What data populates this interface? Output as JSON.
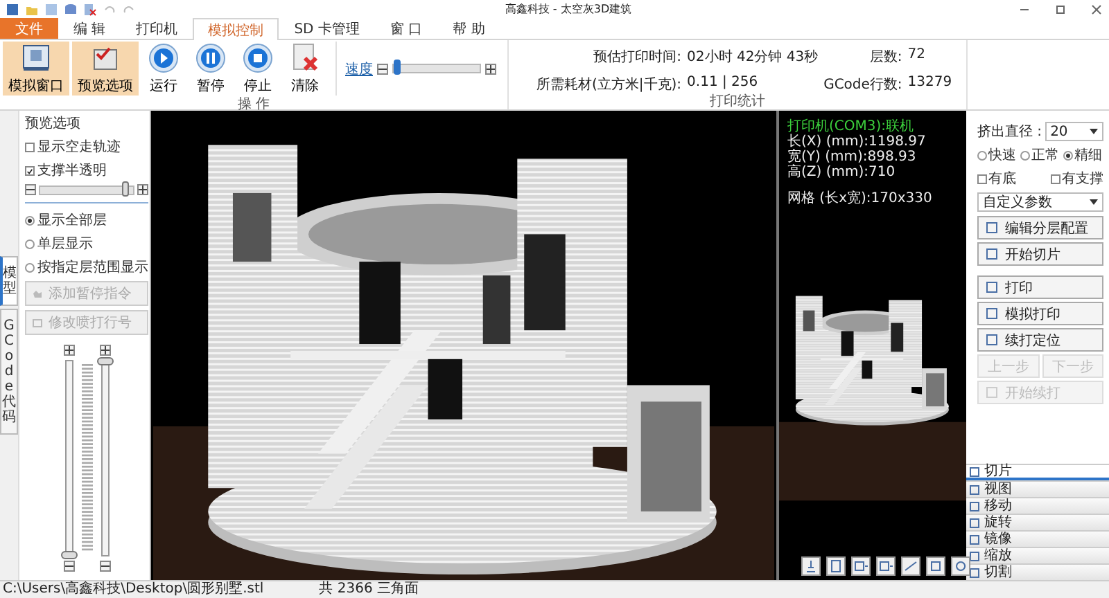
{
  "title_bar": {
    "title": "高鑫科技 - 太空灰3D建筑"
  },
  "menu_tabs": [
    {
      "label": "文件",
      "kind": "file",
      "selected": false
    },
    {
      "label": "编 辑",
      "kind": "tab",
      "selected": false
    },
    {
      "label": "打印机",
      "kind": "tab",
      "selected": false
    },
    {
      "label": "模拟控制",
      "kind": "tab",
      "selected": true
    },
    {
      "label": "SD 卡管理",
      "kind": "tab",
      "selected": false
    },
    {
      "label": "窗 口",
      "kind": "tab",
      "selected": false
    },
    {
      "label": "帮 助",
      "kind": "tab",
      "selected": false
    }
  ],
  "ribbon": {
    "buttons": [
      {
        "label": "模拟窗口",
        "kind": "window",
        "selected": true
      },
      {
        "label": "预览选项",
        "kind": "options",
        "selected": true
      },
      {
        "label": "运行",
        "kind": "play",
        "selected": false
      },
      {
        "label": "暂停",
        "kind": "pause",
        "selected": false
      },
      {
        "label": "停止",
        "kind": "stop",
        "selected": false
      },
      {
        "label": "清除",
        "kind": "clear",
        "selected": false
      }
    ],
    "speed": {
      "label": "速度",
      "level": 0.05
    },
    "group_label": "操 作",
    "stats": {
      "items": [
        {
          "label": "预估打印时间:",
          "value": "02小时 42分钟 43秒"
        },
        {
          "label": "层数:",
          "value": "72"
        },
        {
          "label": "所需耗材(立方米|千克):",
          "value": "0.11 | 256"
        },
        {
          "label": "GCode行数:",
          "value": "13279"
        }
      ],
      "group_label": "打印统计"
    }
  },
  "side_tabs": [
    {
      "label": "模型",
      "selected": true
    },
    {
      "label": "GCode 代码",
      "selected": false
    }
  ],
  "preview_options": {
    "title": "预览选项",
    "checkboxes": [
      {
        "label": "显示空走轨迹",
        "checked": false
      },
      {
        "label": "支撑半透明",
        "checked": true
      }
    ],
    "opacity": {
      "level": 0.92
    },
    "radios": [
      {
        "label": "显示全部层",
        "selected": true
      },
      {
        "label": "单层显示",
        "selected": false
      },
      {
        "label": "按指定层范围显示",
        "selected": false
      }
    ],
    "buttons": [
      {
        "label": "添加暂停指令",
        "kind": "pause",
        "disabled": true
      },
      {
        "label": "修改喷打行号",
        "kind": "edit",
        "disabled": true
      }
    ],
    "layer_low": {
      "level": 0
    },
    "layer_high": {
      "level": 1
    }
  },
  "preview": {
    "status": "打印机(COM3):联机",
    "info": [
      "长(X) (mm):1198.97",
      "宽(Y) (mm):898.93",
      "高(Z) (mm):710"
    ],
    "grid": "网格 (长x宽):170x330"
  },
  "slice_panel": {
    "nozzle": {
      "label": "挤出直径 :",
      "value": "20"
    },
    "quality": [
      {
        "label": "快速",
        "selected": false
      },
      {
        "label": "正常",
        "selected": false
      },
      {
        "label": "精细",
        "selected": true
      }
    ],
    "options": [
      {
        "label": "有底",
        "checked": false
      },
      {
        "label": "有支撑",
        "checked": false
      }
    ],
    "profile": "自定义参数",
    "slice_buttons": [
      {
        "label": "编辑分层配置",
        "disabled": false
      },
      {
        "label": "开始切片",
        "disabled": false
      }
    ],
    "print_buttons": [
      {
        "label": "打印",
        "disabled": false
      },
      {
        "label": "模拟打印",
        "disabled": false
      },
      {
        "label": "续打定位",
        "disabled": false
      }
    ],
    "step_buttons": [
      {
        "label": "上一步",
        "disabled": true
      },
      {
        "label": "下一步",
        "disabled": true
      }
    ],
    "resume_button": {
      "label": "开始续打",
      "disabled": true
    }
  },
  "bottom_tabs": [
    {
      "label": "切片",
      "selected": true
    },
    {
      "label": "视图",
      "selected": false
    },
    {
      "label": "移动",
      "selected": false
    },
    {
      "label": "旋转",
      "selected": false
    },
    {
      "label": "镜像",
      "selected": false
    },
    {
      "label": "缩放",
      "selected": false
    },
    {
      "label": "切割",
      "selected": false
    }
  ],
  "status_bar": {
    "path": "C:\\Users\\高鑫科技\\Desktop\\圆形别墅.stl",
    "faces": "共 2366 三角面"
  }
}
